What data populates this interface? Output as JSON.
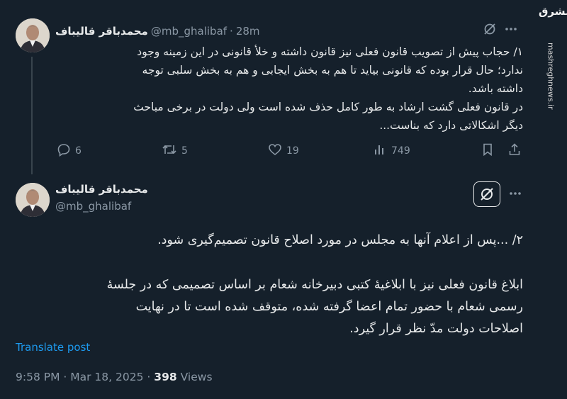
{
  "watermark": {
    "logo_text": "مشرق",
    "site": "mashreghnews.ir"
  },
  "tweet1": {
    "name": "محمدباقر قالیباف",
    "handle": "@mb_ghalibaf",
    "separator": "·",
    "time": "28m",
    "lines": [
      "۱/ حجاب پیش از تصویب قانون فعلی نیز قانون داشته و خلأ قانونی در این زمینه وجود",
      "ندارد؛ حال قرار بوده که قانونی بیاید تا هم به بخش ایجابی و هم به بخش سلبی توجه",
      "داشته باشد.",
      "در قانون فعلی گشت ارشاد به طور کامل حذف شده است ولی دولت در برخی مباحث",
      "دیگر اشکالاتی دارد که بناست..."
    ],
    "replies": "6",
    "reposts": "5",
    "likes": "19",
    "views": "749"
  },
  "tweet2": {
    "name": "محمدباقر قالیباف",
    "handle": "@mb_ghalibaf",
    "paragraph1": "۲/ ...پس از اعلام آنها به مجلس در مورد اصلاح قانون تصمیم‌گیری شود.",
    "paragraph2_lines": [
      "ابلاغ قانون فعلی نیز با ابلاغیهٔ کتبی دبیرخانه شعام بر اساس تصمیمی که در جلسهٔ",
      "رسمی شعام با حضور تمام اعضا گرفته شده، متوقف شده است تا در نهایت",
      "اصلاحات دولت مدّ نظر قرار گیرد."
    ],
    "translate_label": "Translate post",
    "timestamp": "9:58 PM · Mar 18, 2025 ·",
    "views_count": "398",
    "views_label": "Views"
  },
  "colors": {
    "background": "#15202b",
    "text": "#e7e9ea",
    "muted": "#8b98a5",
    "link": "#1d9bf0"
  },
  "icons": [
    "reply-icon",
    "repost-icon",
    "like-icon",
    "views-icon",
    "bookmark-icon",
    "share-icon",
    "grok-icon",
    "more-icon"
  ]
}
